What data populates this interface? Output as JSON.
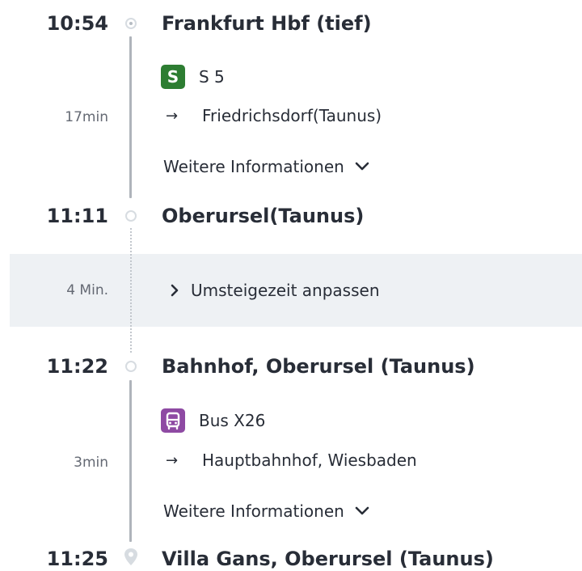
{
  "segments": [
    {
      "dep_time": "10:54",
      "dep_stop": "Frankfurt Hbf (tief)",
      "line_badge": "S",
      "line_name": "S 5",
      "duration": "17min",
      "direction": "Friedrichsdorf(Taunus)",
      "more_info": "Weitere Informationen",
      "arr_time": "11:11",
      "arr_stop": "Oberursel(Taunus)"
    },
    {
      "dep_time": "11:22",
      "dep_stop": "Bahnhof, Oberursel (Taunus)",
      "line_name": "Bus X26",
      "duration": "3min",
      "direction": "Hauptbahnhof, Wiesbaden",
      "more_info": "Weitere Informationen",
      "arr_time": "11:25",
      "arr_stop": "Villa Gans, Oberursel (Taunus)"
    }
  ],
  "transfer": {
    "duration": "4 Min.",
    "action_label": "Umsteigezeit anpassen"
  },
  "colors": {
    "sbahn": "#2d7d32",
    "bus": "#8e4aa3",
    "transfer_bg": "#eef1f4"
  },
  "icons": {
    "sbahn": "s-bahn-icon",
    "bus": "bus-icon",
    "arrow": "arrow-right-icon",
    "expand": "chevron-down-icon",
    "transfer_action": "chevron-right-icon",
    "destination": "location-pin-icon"
  }
}
